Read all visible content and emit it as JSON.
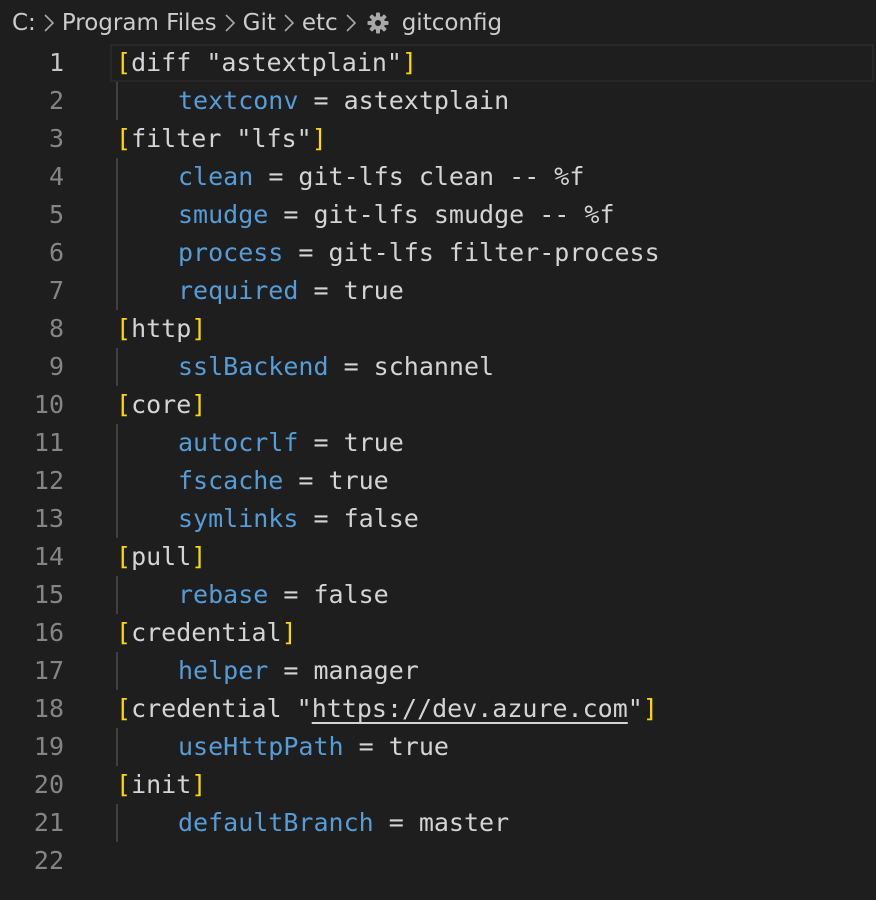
{
  "breadcrumb": {
    "items": [
      "C:",
      "Program Files",
      "Git",
      "etc"
    ],
    "file": "gitconfig",
    "file_icon": "gear-icon"
  },
  "editor": {
    "active_line": 1,
    "lines": [
      {
        "n": "1",
        "type": "section",
        "name": "diff \"astextplain\""
      },
      {
        "n": "2",
        "type": "kv",
        "key": "textconv",
        "eq": " = ",
        "value": "astextplain"
      },
      {
        "n": "3",
        "type": "section",
        "name": "filter \"lfs\""
      },
      {
        "n": "4",
        "type": "kv",
        "key": "clean",
        "eq": " = ",
        "value": "git-lfs clean -- %f"
      },
      {
        "n": "5",
        "type": "kv",
        "key": "smudge",
        "eq": " = ",
        "value": "git-lfs smudge -- %f"
      },
      {
        "n": "6",
        "type": "kv",
        "key": "process",
        "eq": " = ",
        "value": "git-lfs filter-process"
      },
      {
        "n": "7",
        "type": "kv",
        "key": "required",
        "eq": " = ",
        "value": "true"
      },
      {
        "n": "8",
        "type": "section",
        "name": "http"
      },
      {
        "n": "9",
        "type": "kv",
        "key": "sslBackend",
        "eq": " = ",
        "value": "schannel"
      },
      {
        "n": "10",
        "type": "section",
        "name": "core"
      },
      {
        "n": "11",
        "type": "kv",
        "key": "autocrlf",
        "eq": " = ",
        "value": "true"
      },
      {
        "n": "12",
        "type": "kv",
        "key": "fscache",
        "eq": " = ",
        "value": "true"
      },
      {
        "n": "13",
        "type": "kv",
        "key": "symlinks",
        "eq": " = ",
        "value": "false"
      },
      {
        "n": "14",
        "type": "section",
        "name": "pull"
      },
      {
        "n": "15",
        "type": "kv",
        "key": "rebase",
        "eq": " = ",
        "value": "false"
      },
      {
        "n": "16",
        "type": "section",
        "name": "credential"
      },
      {
        "n": "17",
        "type": "kv",
        "key": "helper",
        "eq": " = ",
        "value": "manager"
      },
      {
        "n": "18",
        "type": "section_url",
        "prefix": "credential \"",
        "url": "https://dev.azure.com",
        "suffix": "\""
      },
      {
        "n": "19",
        "type": "kv",
        "key": "useHttpPath",
        "eq": " = ",
        "value": "true"
      },
      {
        "n": "20",
        "type": "section",
        "name": "init"
      },
      {
        "n": "21",
        "type": "kv",
        "key": "defaultBranch",
        "eq": " = ",
        "value": "master"
      },
      {
        "n": "22",
        "type": "empty"
      }
    ]
  },
  "colors": {
    "background": "#1e1e1e",
    "bracket": "#ffd700",
    "key": "#569cd6",
    "text": "#d4d4d4",
    "line_number": "#858585",
    "line_number_active": "#c6c6c6",
    "indent_guide": "#404040"
  }
}
